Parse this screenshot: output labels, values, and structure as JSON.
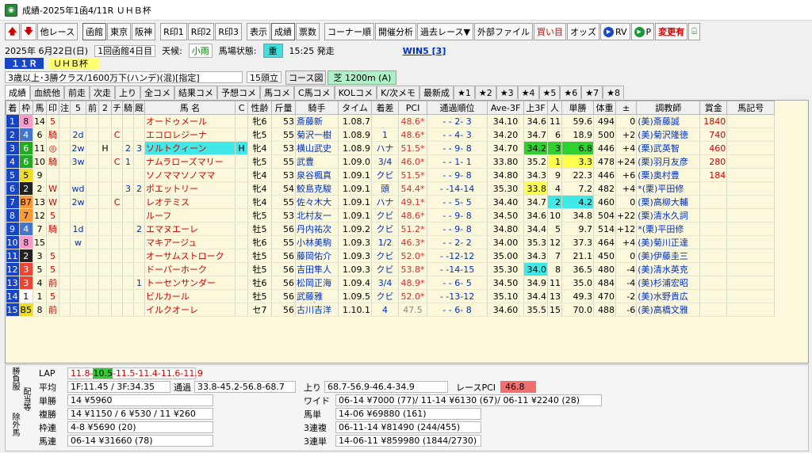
{
  "window": {
    "title": "成績‐2025年1函4/11R ＵＨＢ杯"
  },
  "toolbar": {
    "items": [
      "他レース",
      "函館",
      "東京",
      "阪神",
      "R印1",
      "R印2",
      "R印3",
      "表示",
      "成績",
      "票数",
      "コーナー順",
      "開催分析",
      "過去レース▼",
      "外部ファイル",
      "買い目",
      "オッズ",
      "RV",
      "P",
      "変更有"
    ]
  },
  "race": {
    "date": "2025年 6月22日(日)",
    "kaisai": "1回函館4日目",
    "weather_label": "天候:",
    "weather": "小雨",
    "baba_label": "馬場状態:",
    "baba": "重",
    "time": "15:25 発走",
    "win5": "WIN5 [3]",
    "rno": "１１Ｒ",
    "name": "ＵＨＢ杯",
    "cond": "3歳以上･3勝クラス/1600万下(ハンデ)(混)[指定]",
    "heads": "15頭立",
    "course_label": "コース図",
    "course": "芝 1200m (A)"
  },
  "tabs": [
    "成績",
    "血統他",
    "前走",
    "次走",
    "上り",
    "全コメ",
    "結果コメ",
    "予想コメ",
    "馬コメ",
    "C馬コメ",
    "KOLコメ",
    "K/次メモ",
    "最新成",
    "★1",
    "★2",
    "★3",
    "★4",
    "★5",
    "★6",
    "★7",
    "★8"
  ],
  "columns": [
    "着",
    "枠",
    "馬",
    "印",
    "注",
    "5",
    "前",
    "2",
    "チ",
    "騎",
    "厩",
    "馬 名",
    "C",
    "性齢",
    "斤量",
    "騎手",
    "タイム",
    "着差",
    "PCI",
    "通過順位",
    "Ave-3F",
    "上3F",
    "人",
    "単勝",
    "体重",
    "±",
    "調教師",
    "賞金",
    "馬記号"
  ],
  "rows": [
    {
      "c": [
        "1",
        "8",
        "14",
        "5",
        "",
        "",
        "",
        "",
        "",
        "",
        "",
        "オードゥメール",
        "",
        "牝6",
        "53",
        "斎藤新",
        "1.08.7",
        "",
        "48.6*",
        "- - 2- 3",
        "34.10",
        "34.6",
        "11",
        "59.6",
        "494",
        "0",
        "(美)斎藤誠",
        "1840",
        ""
      ]
    },
    {
      "c": [
        "2",
        "4",
        "6",
        "騎",
        "",
        "2d",
        "",
        "",
        "C",
        "",
        "",
        "エコロレジーナ",
        "",
        "牝5",
        "55",
        "菊沢一樹",
        "1.08.9",
        "1",
        "48.6*",
        "- - 4- 3",
        "34.20",
        "34.7",
        "6",
        "18.9",
        "500",
        "+2",
        "(美)菊沢隆徳",
        "740",
        ""
      ]
    },
    {
      "c": [
        "3",
        "6",
        "11",
        "◎",
        "",
        "2w",
        "",
        "H",
        "",
        "2",
        "3",
        "ソルトクィーン",
        "H",
        "牝4",
        "53",
        "横山武史",
        "1.08.9",
        "ハナ",
        "51.5*",
        "- - 9- 8",
        "34.70",
        "34.2",
        "3",
        "6.8",
        "446",
        "+4",
        "(栗)武英智",
        "460",
        ""
      ]
    },
    {
      "c": [
        "4",
        "6",
        "10",
        "騎",
        "",
        "3w",
        "",
        "",
        "C",
        "1",
        "",
        "ナムラローズマリー",
        "",
        "牝5",
        "55",
        "武豊",
        "1.09.0",
        "3/4",
        "46.0*",
        "- - 1- 1",
        "33.80",
        "35.2",
        "1",
        "3.3",
        "478",
        "+24",
        "(栗)羽月友彦",
        "280",
        ""
      ]
    },
    {
      "c": [
        "5",
        "5",
        "9",
        "",
        "",
        "",
        "",
        "",
        "",
        "",
        "",
        "ソノママソノママ",
        "",
        "牝4",
        "53",
        "泉谷楓真",
        "1.09.1",
        "クビ",
        "51.5*",
        "- - 9- 8",
        "34.80",
        "34.3",
        "9",
        "22.3",
        "446",
        "+6",
        "(栗)奥村豊",
        "184",
        ""
      ]
    },
    {
      "c": [
        "6",
        "2",
        "2",
        "W",
        "",
        "wd",
        "",
        "",
        "",
        "3",
        "2",
        "ポエットリー",
        "",
        "牝4",
        "54",
        "鮫島克駿",
        "1.09.1",
        "頭",
        "54.4*",
        "- -14-14",
        "35.30",
        "33.8",
        "4",
        "7.2",
        "482",
        "+4",
        "*(栗)平田修",
        "",
        ""
      ]
    },
    {
      "c": [
        "7",
        "B7",
        "13",
        "W",
        "",
        "2w",
        "",
        "",
        "C",
        "",
        "",
        "レオテミス",
        "",
        "牝4",
        "55",
        "佐々木大",
        "1.09.1",
        "ハナ",
        "49.1*",
        "- - 5- 5",
        "34.40",
        "34.7",
        "2",
        "4.2",
        "460",
        "0",
        "(栗)高柳大輔",
        "",
        ""
      ]
    },
    {
      "c": [
        "8",
        "7",
        "12",
        "5",
        "",
        "",
        "",
        "",
        "",
        "",
        "",
        "ルーフ",
        "",
        "牝5",
        "53",
        "北村友一",
        "1.09.1",
        "クビ",
        "48.6*",
        "- - 9- 8",
        "34.50",
        "34.6",
        "10",
        "34.8",
        "504",
        "+22",
        "(栗)清水久詞",
        "",
        ""
      ]
    },
    {
      "c": [
        "9",
        "4",
        "7",
        "騎",
        "",
        "1d",
        "",
        "",
        "",
        "",
        "2",
        "エマヌエーレ",
        "",
        "牡5",
        "56",
        "丹内祐次",
        "1.09.2",
        "クビ",
        "51.2*",
        "- - 9- 8",
        "34.80",
        "34.4",
        "5",
        "9.7",
        "514",
        "+12",
        "*(栗)平田修",
        "",
        ""
      ]
    },
    {
      "c": [
        "10",
        "8",
        "15",
        "",
        "",
        "w",
        "",
        "",
        "",
        "",
        "",
        "マキアージュ",
        "",
        "牝6",
        "55",
        "小林美駒",
        "1.09.3",
        "1/2",
        "46.3*",
        "- - 2- 2",
        "34.00",
        "35.3",
        "12",
        "37.3",
        "464",
        "+4",
        "(美)菊川正達",
        "",
        ""
      ]
    },
    {
      "c": [
        "11",
        "2",
        "3",
        "5",
        "",
        "",
        "",
        "",
        "",
        "",
        "",
        "オーサムストローク",
        "",
        "牡5",
        "56",
        "藤岡佑介",
        "1.09.3",
        "クビ",
        "52.0*",
        "- -12-12",
        "35.00",
        "34.3",
        "7",
        "21.1",
        "450",
        "0",
        "(美)伊藤圭三",
        "",
        ""
      ]
    },
    {
      "c": [
        "12",
        "3",
        "5",
        "5",
        "",
        "",
        "",
        "",
        "",
        "",
        "",
        "ドーパーホーク",
        "",
        "牡5",
        "56",
        "吉田隼人",
        "1.09.3",
        "クビ",
        "53.8*",
        "- -14-15",
        "35.30",
        "34.0",
        "8",
        "36.5",
        "480",
        "-4",
        "(美)清水英克",
        "",
        ""
      ]
    },
    {
      "c": [
        "13",
        "3",
        "4",
        "前",
        "",
        "",
        "",
        "",
        "",
        "",
        "1",
        "トーセンサンダー",
        "",
        "牡6",
        "56",
        "松岡正海",
        "1.09.4",
        "3/4",
        "48.9*",
        "- - 6- 5",
        "34.50",
        "34.9",
        "11",
        "35.0",
        "484",
        "-4",
        "(美)杉浦宏昭",
        "",
        ""
      ]
    },
    {
      "c": [
        "14",
        "1",
        "1",
        "5",
        "",
        "",
        "",
        "",
        "",
        "",
        "",
        "ビルカール",
        "",
        "牡5",
        "56",
        "武藤雅",
        "1.09.5",
        "クビ",
        "52.0*",
        "- -13-12",
        "35.10",
        "34.4",
        "13",
        "49.3",
        "470",
        "-2",
        "(美)水野貴広",
        "",
        ""
      ]
    },
    {
      "c": [
        "15",
        "B5",
        "8",
        "前",
        "",
        "",
        "",
        "",
        "",
        "",
        "",
        "イルクオーレ",
        "",
        "セ7",
        "56",
        "古川吉洋",
        "1.10.1",
        "4",
        "47.5",
        "- - 6- 8",
        "34.60",
        "35.5",
        "15",
        "70.0",
        "488",
        "-6",
        "(美)高橋文雅",
        "",
        ""
      ]
    }
  ],
  "bottom": {
    "side_tabs": [
      "勝負服",
      "配当等",
      "除外馬"
    ],
    "lap_label": "LAP",
    "lap": [
      "11.8-",
      "10.5",
      "-11.5-11.4-11.6-11.9"
    ],
    "avg_label": "平均",
    "avg": "1F:11.45 / 3F:34.35",
    "tsuka_label": "通過",
    "tsuka": "33.8-45.2-56.8-68.7",
    "agari_label": "上り",
    "agari": "68.7-56.9-46.4-34.9",
    "rpci_label": "レースPCI",
    "rpci": "46.8",
    "tansho_label": "単勝",
    "tansho": "14 ¥5960",
    "fukusho_label": "複勝",
    "fukusho": "14 ¥1150 / 6 ¥530 / 11 ¥260",
    "wakuren_label": "枠連",
    "wakuren": "4-8 ¥5690 (20)",
    "umaren_label": "馬連",
    "umaren": "06-14 ¥31660 (78)",
    "wide_label": "ワイド",
    "wide": "06-14 ¥7000 (77)/ 11-14 ¥6130 (67)/ 06-11 ¥2240 (28)",
    "umatan_label": "馬単",
    "umatan": "14-06 ¥69880 (161)",
    "sanrenpuku_label": "3連複",
    "sanrenpuku": "06-11-14 ¥81490 (244/455)",
    "sanrentan_label": "3連単",
    "sanrentan": "14-06-11 ¥859980 (1844/2730)"
  }
}
